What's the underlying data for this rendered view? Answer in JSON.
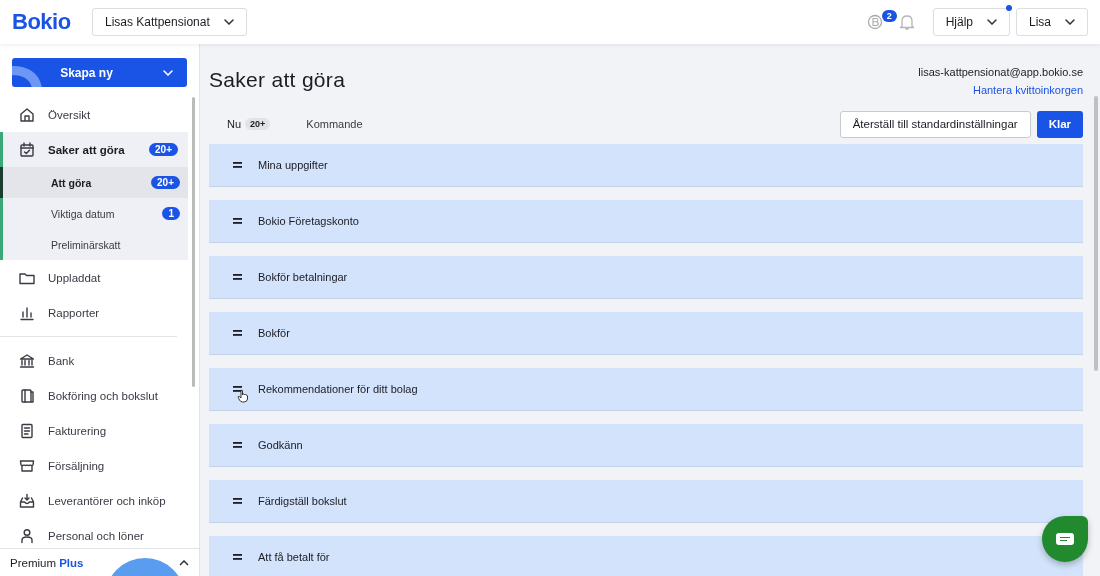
{
  "header": {
    "logo": "Bokio",
    "company": "Lisas Kattpensionat",
    "coin_badge": "2",
    "help": {
      "label": "Hjälp",
      "notification": true
    },
    "user": "Lisa"
  },
  "sidebar": {
    "create_button": "Skapa ny",
    "nav": [
      {
        "label": "Översikt",
        "selected": false
      },
      {
        "label": "Saker att göra",
        "badge": "20+",
        "selected": true,
        "children": [
          {
            "label": "Att göra",
            "badge": "20+",
            "selected": true
          },
          {
            "label": "Viktiga datum",
            "badge": "1",
            "selected": false
          },
          {
            "label": "Preliminärskatt",
            "selected": false
          }
        ]
      },
      {
        "label": "Uppladdat",
        "selected": false
      },
      {
        "label": "Rapporter",
        "selected": false
      }
    ],
    "nav2": [
      {
        "label": "Bank",
        "selected": false
      },
      {
        "label": "Bokföring och bokslut",
        "selected": false
      },
      {
        "label": "Fakturering",
        "selected": false
      },
      {
        "label": "Försäljning",
        "selected": false
      },
      {
        "label": "Leverantörer och inköp",
        "selected": false
      },
      {
        "label": "Personal och löner",
        "selected": false
      }
    ],
    "plan": "Premium **Plus**"
  },
  "main": {
    "title": "Saker att göra",
    "email": "lisas-kattpensionat@app.bokio.se",
    "inbox_link": "Hantera kvittoinkorgen",
    "tabs": [
      {
        "label": "Nu",
        "badge": "20+",
        "selected": true
      },
      {
        "label": "Kommande",
        "selected": false
      }
    ],
    "buttons": {
      "reset": "Återställ till standardinställningar",
      "done": "Klar"
    },
    "sections": [
      {
        "label": "Mina uppgifter"
      },
      {
        "label": "Bokio Företagskonto"
      },
      {
        "label": "Bokför betalningar"
      },
      {
        "label": "Bokför"
      },
      {
        "label": "Rekommendationer för ditt bolag"
      },
      {
        "label": "Godkänn"
      },
      {
        "label": "Färdigställ bokslut"
      },
      {
        "label": "Att få betalt för"
      }
    ]
  }
}
